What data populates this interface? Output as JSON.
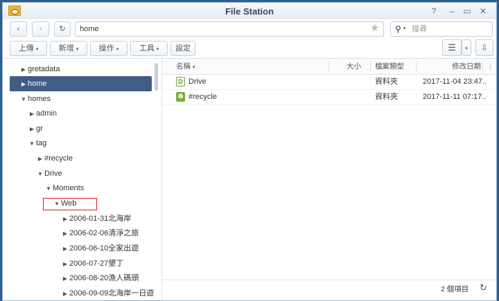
{
  "window": {
    "title": "File Station"
  },
  "toolbar": {
    "path": "home",
    "search_placeholder": "搜尋",
    "upload_label": "上傳",
    "create_label": "新增",
    "action_label": "操作",
    "tools_label": "工具",
    "settings_label": "設定"
  },
  "tree": {
    "gretadata": "gretadata",
    "home": "home",
    "homes": "homes",
    "admin": "admin",
    "gr": "gr",
    "tag": "tag",
    "recycle": "#recycle",
    "drive": "Drive",
    "moments": "Moments",
    "web": "Web",
    "folders": [
      "2006-01-31北海岸",
      "2006-02-06清淨之旅",
      "2006-06-10全家出遊",
      "2006-07-27墾丁",
      "2006-08-20漁人碼頭",
      "2006-09-09北海岸一日遊"
    ]
  },
  "grid": {
    "columns": {
      "name": "名稱",
      "size": "大小",
      "type": "檔案類型",
      "modified": "修改日期"
    },
    "rows": [
      {
        "name": "Drive",
        "size": "",
        "type": "資料夾",
        "modified": "2017-11-04 23:47..."
      },
      {
        "name": "#recycle",
        "size": "",
        "type": "資料夾",
        "modified": "2017-11-11 07:17..."
      }
    ]
  },
  "footer": {
    "count": "2 個項目"
  }
}
